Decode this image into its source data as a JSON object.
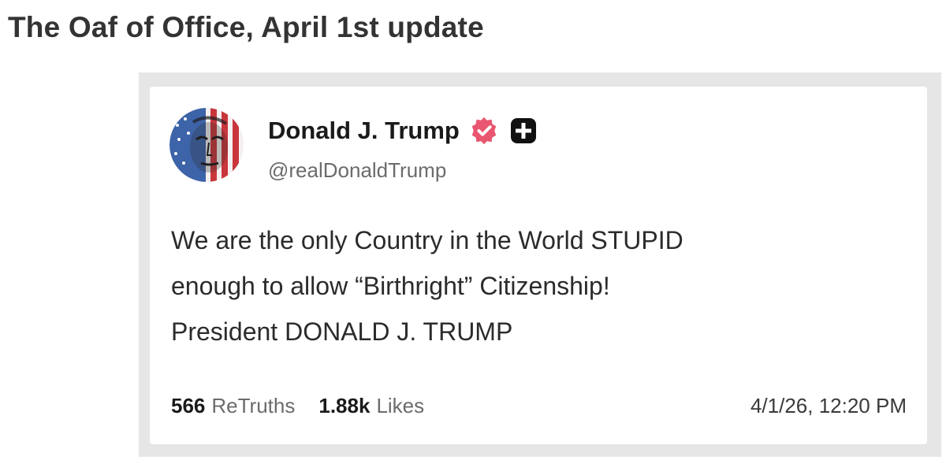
{
  "page": {
    "title": "The Oaf of Office, April 1st update"
  },
  "post": {
    "author": {
      "name": "Donald J. Trump",
      "handle": "@realDonaldTrump",
      "avatar_icon": "flag-portrait-avatar",
      "verified_icon": "verified-badge-icon",
      "verified_color": "#e8576f",
      "plus_icon": "plus-badge-icon"
    },
    "body_lines": [
      "We are the only Country in the World STUPID",
      "enough to allow “Birthright” Citizenship!",
      "President DONALD J. TRUMP"
    ],
    "stats": {
      "retruths_count": "566",
      "retruths_label": "ReTruths",
      "likes_count": "1.88k",
      "likes_label": "Likes"
    },
    "timestamp": "4/1/26, 12:20 PM"
  }
}
